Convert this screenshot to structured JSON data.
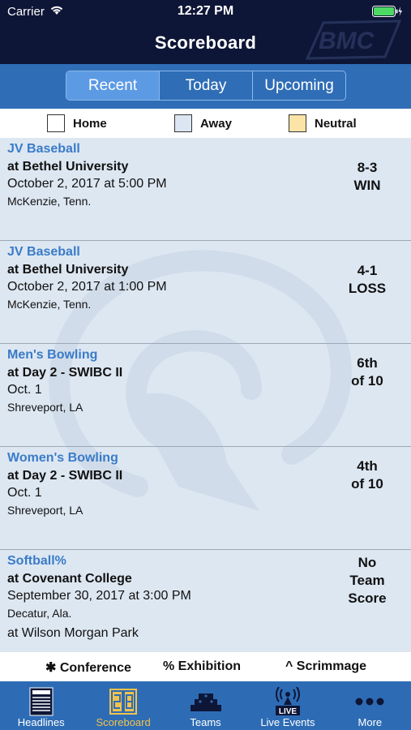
{
  "status_bar": {
    "carrier": "Carrier",
    "time": "12:27 PM"
  },
  "header": {
    "title": "Scoreboard",
    "logo_text": "BMC"
  },
  "segments": [
    {
      "label": "Recent",
      "active": true
    },
    {
      "label": "Today",
      "active": false
    },
    {
      "label": "Upcoming",
      "active": false
    }
  ],
  "legend": {
    "home": {
      "label": "Home",
      "color": "#ffffff"
    },
    "away": {
      "label": "Away",
      "color": "#dce6f2"
    },
    "neutral": {
      "label": "Neutral",
      "color": "#fbe4a6"
    }
  },
  "games": [
    {
      "sport": "JV Baseball",
      "opponent": "at Bethel University",
      "date": "October 2, 2017 at 5:00 PM",
      "location": "McKenzie, Tenn.",
      "extra": "",
      "result_line1": "8-3",
      "result_line2": "WIN",
      "result_line3": ""
    },
    {
      "sport": "JV Baseball",
      "opponent": "at Bethel University",
      "date": "October 2, 2017 at 1:00 PM",
      "location": "McKenzie, Tenn.",
      "extra": "",
      "result_line1": "4-1",
      "result_line2": "LOSS",
      "result_line3": ""
    },
    {
      "sport": "Men's Bowling",
      "opponent": "at Day 2 - SWIBC II",
      "date": "Oct. 1",
      "location": "Shreveport, LA",
      "extra": "",
      "result_line1": "6th",
      "result_line2": "of 10",
      "result_line3": ""
    },
    {
      "sport": "Women's Bowling",
      "opponent": "at Day 2 - SWIBC II",
      "date": "Oct. 1",
      "location": "Shreveport, LA",
      "extra": "",
      "result_line1": "4th",
      "result_line2": "of 10",
      "result_line3": ""
    },
    {
      "sport": "Softball%",
      "opponent": "at Covenant College",
      "date": "September 30, 2017 at 3:00 PM",
      "location": "Decatur, Ala.",
      "extra": "at Wilson Morgan Park",
      "result_line1": "No",
      "result_line2": "Team",
      "result_line3": "Score"
    }
  ],
  "footnotes": {
    "conference": "✱ Conference",
    "exhibition": "% Exhibition",
    "scrimmage": "^  Scrimmage"
  },
  "tabs": [
    {
      "label": "Headlines",
      "icon": "newspaper-icon",
      "active": false
    },
    {
      "label": "Scoreboard",
      "icon": "scoreboard-icon",
      "active": true
    },
    {
      "label": "Teams",
      "icon": "bleachers-icon",
      "active": false
    },
    {
      "label": "Live Events",
      "icon": "live-tower-icon",
      "active": false
    },
    {
      "label": "More",
      "icon": "more-dots-icon",
      "active": false
    }
  ]
}
